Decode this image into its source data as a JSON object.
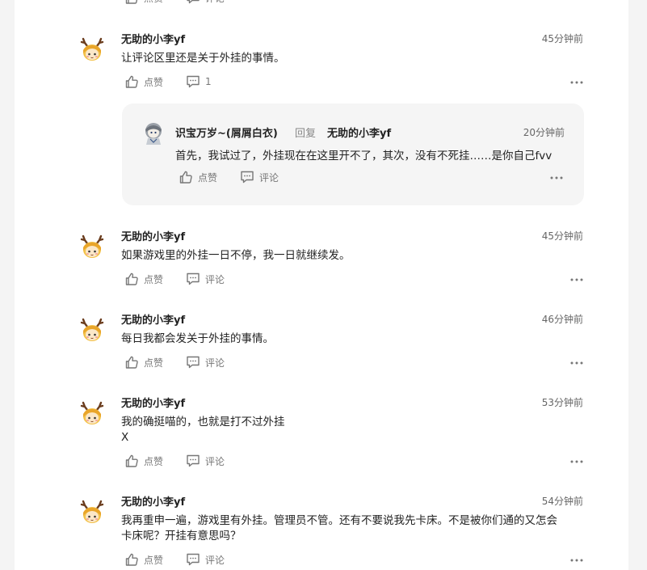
{
  "labels": {
    "like": "点赞",
    "comment": "评论"
  },
  "top_partial": {
    "like": "点赞",
    "comment": "评论"
  },
  "comments": [
    {
      "username": "无助的小李yf",
      "time": "45分钟前",
      "lines": [
        "让评论区里还是关于外挂的事情。"
      ],
      "like": "点赞",
      "comment_count": "1"
    },
    {
      "username": "无助的小李yf",
      "time": "45分钟前",
      "lines": [
        "如果游戏里的外挂一日不停，我一日就继续发。"
      ],
      "like": "点赞",
      "comment_count": "评论"
    },
    {
      "username": "无助的小李yf",
      "time": "46分钟前",
      "lines": [
        "每日我都会发关于外挂的事情。"
      ],
      "like": "点赞",
      "comment_count": "评论"
    },
    {
      "username": "无助的小李yf",
      "time": "53分钟前",
      "lines": [
        "我的确挺喵的，也就是打不过外挂",
        "X"
      ],
      "like": "点赞",
      "comment_count": "评论"
    },
    {
      "username": "无助的小李yf",
      "time": "54分钟前",
      "lines": [
        "我再重申一遍，游戏里有外挂。管理员不管。还有不要说我先卡床。不是被你们通的又怎会",
        "卡床呢？开挂有意思吗？"
      ],
      "like": "点赞",
      "comment_count": "评论"
    }
  ],
  "reply": {
    "username": "识宝万岁~(屑屑白衣)",
    "reply_word": "回复",
    "target": "无助的小李yf",
    "time": "20分钟前",
    "text": "首先，我试过了，外挂现在在这里开不了，其次，没有不死挂……是你自己fvv",
    "like": "点赞",
    "comment": "评论"
  },
  "colors": {
    "background": "#f4f4f4",
    "panel": "#ffffff",
    "reply_box": "#f5f5f5",
    "muted": "#777777"
  },
  "icons": {
    "like": "thumbs-up-icon",
    "comment": "comment-icon",
    "more": "more-dots-icon",
    "avatar": "deer-avatar-icon"
  }
}
